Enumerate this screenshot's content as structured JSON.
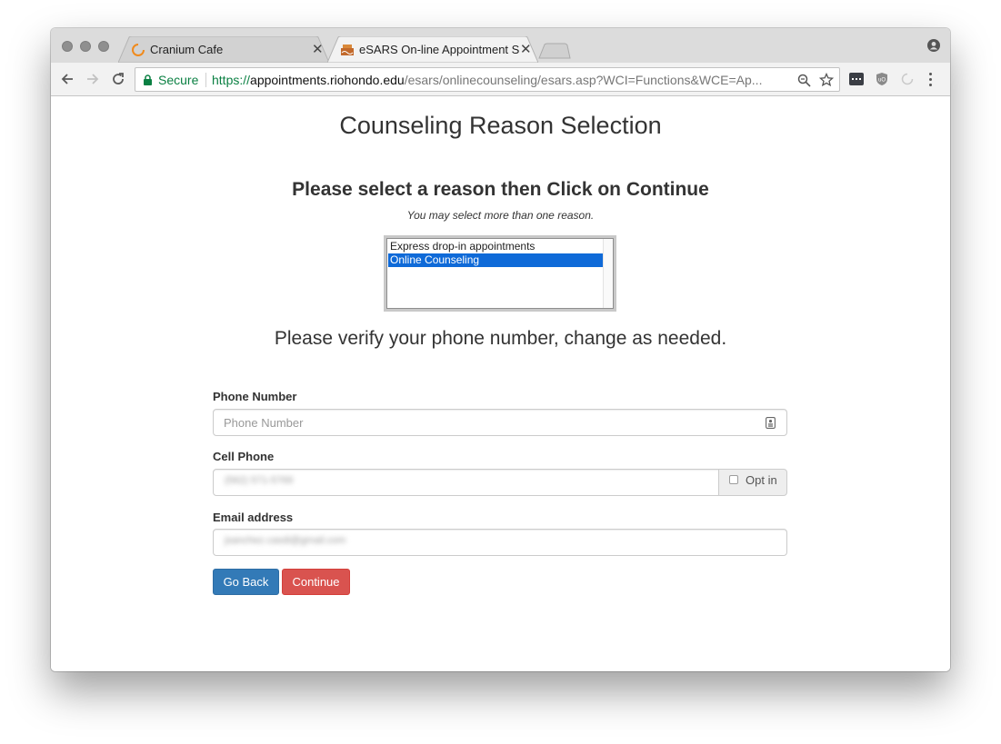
{
  "browser": {
    "tabs": [
      {
        "title": "Cranium Cafe",
        "active": false,
        "favicon": "loading-spinner-icon"
      },
      {
        "title": "eSARS On-line Appointment S",
        "active": true,
        "favicon": "college-seal-icon"
      }
    ],
    "omnibox": {
      "security_label": "Secure",
      "url_scheme": "https://",
      "url_host": "appointments.riohondo.edu",
      "url_path": "/esars/onlinecounseling/esars.asp?WCI=Functions&WCE=Ap..."
    }
  },
  "page": {
    "title": "Counseling Reason Selection",
    "reason_heading": "Please select a reason then Click on Continue",
    "reason_hint": "You may select more than one reason.",
    "reasons": [
      {
        "label": "Express drop-in appointments",
        "selected": false
      },
      {
        "label": "Online Counseling",
        "selected": true
      }
    ],
    "phone_heading": "Please verify your phone number, change as needed.",
    "form": {
      "phone_label": "Phone Number",
      "phone_placeholder": "Phone Number",
      "cell_label": "Cell Phone",
      "cell_value": "(562) 571-5769",
      "opt_in_label": "Opt in",
      "email_label": "Email address",
      "email_value": "jsanchez.casdi@gmail.com"
    },
    "buttons": {
      "back": "Go Back",
      "continue": "Continue"
    }
  },
  "colors": {
    "primary": "#337ab7",
    "danger": "#d9534f",
    "selection": "#0f6ad8",
    "secure_green": "#0b8043"
  }
}
